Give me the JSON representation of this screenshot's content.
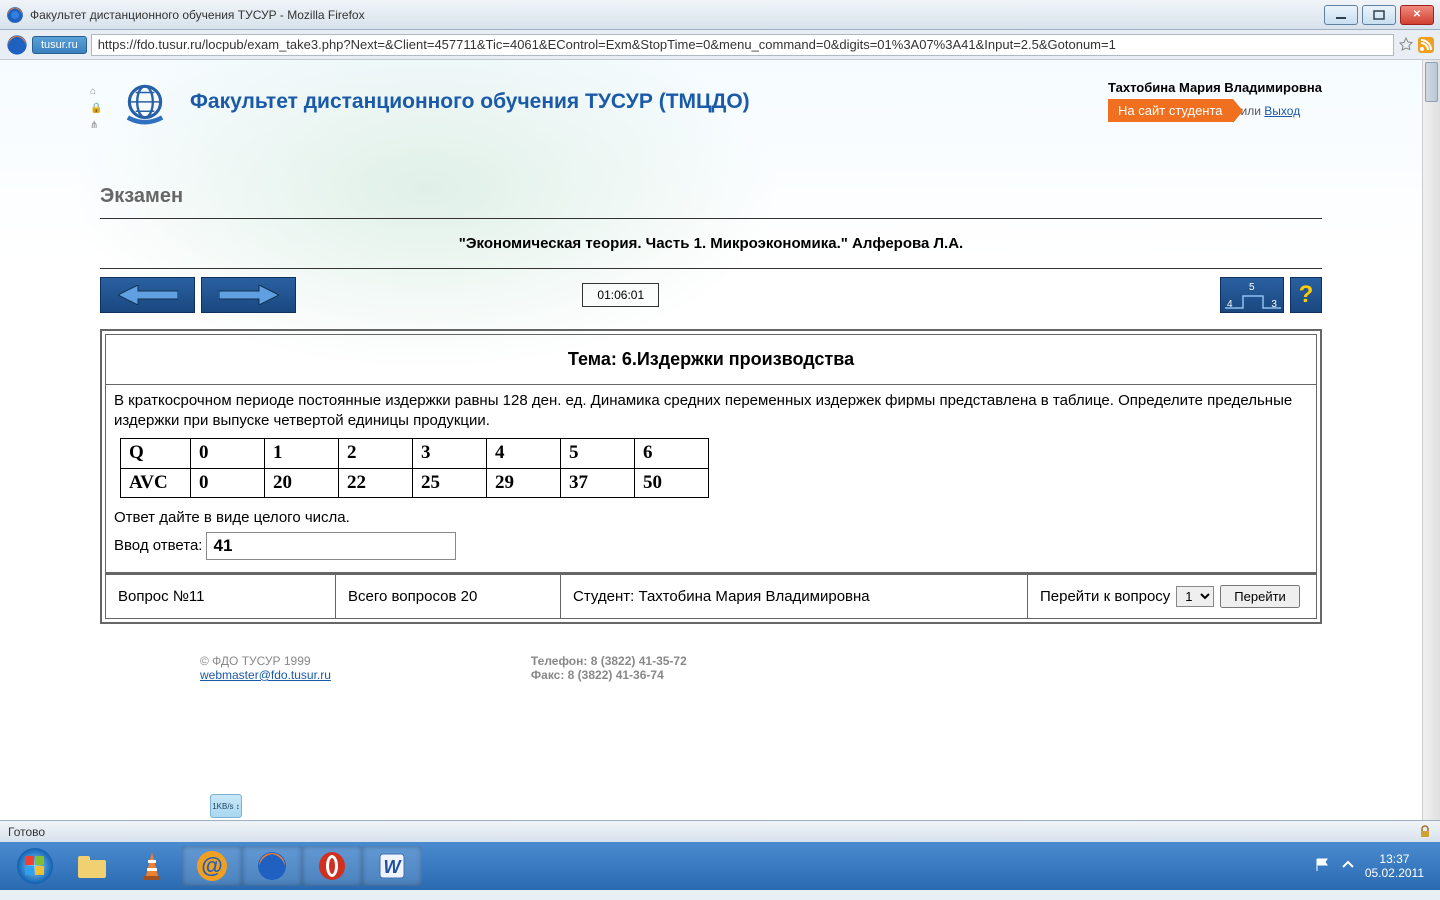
{
  "window": {
    "title": "Факультет дистанционного обучения ТУСУР - Mozilla Firefox"
  },
  "urlbar": {
    "sitechip": "tusur.ru",
    "url": "https://fdo.tusur.ru/locpub/exam_take3.php?Next=&Client=457711&Tic=4061&EControl=Exm&StopTime=0&menu_command=0&digits=01%3A07%3A41&Input=2.5&Gotonum=1"
  },
  "site": {
    "title": "Факультет дистанционного обучения ТУСУР (ТМЦДО)",
    "username": "Тахтобина Мария Владимировна",
    "student_btn": "На сайт студента",
    "or": "или",
    "logout": "Выход"
  },
  "exam": {
    "heading": "Экзамен",
    "course": "\"Экономическая теория. Часть 1. Микроэкономика.\" Алферова Л.А.",
    "timer": "01:06:01",
    "progress": {
      "left": "4",
      "mid": "5",
      "right": "3"
    },
    "theme": "Тема: 6.Издержки производства",
    "question": "В краткосрочном периоде постоянные издержки равны 128 ден. ед. Динамика средних переменных издержек фирмы представлена в таблице. Определите предельные издержки при выпуске четвертой единицы продукции.",
    "table": {
      "rows": [
        [
          "Q",
          "0",
          "1",
          "2",
          "3",
          "4",
          "5",
          "6"
        ],
        [
          "AVC",
          "0",
          "20",
          "22",
          "25",
          "29",
          "37",
          "50"
        ]
      ]
    },
    "hint": "Ответ дайте в виде целого числа.",
    "answer_label": "Ввод ответа:",
    "answer_value": "41",
    "qnum_label": "Вопрос №11",
    "total_label": "Всего вопросов 20",
    "student_label": "Студент: Тахтобина Мария Владимировна",
    "goto_label": "Перейти к вопросу",
    "goto_value": "1",
    "goto_btn": "Перейти"
  },
  "footer": {
    "copyright": "© ФДО ТУСУР 1999",
    "email": "webmaster@fdo.tusur.ru",
    "phone": "Телефон: 8 (3822) 41-35-72",
    "fax": "Факс: 8 (3822) 41-36-74"
  },
  "statusbar": {
    "text": "Готово"
  },
  "taskbar": {
    "time": "13:37",
    "date": "05.02.2011"
  }
}
